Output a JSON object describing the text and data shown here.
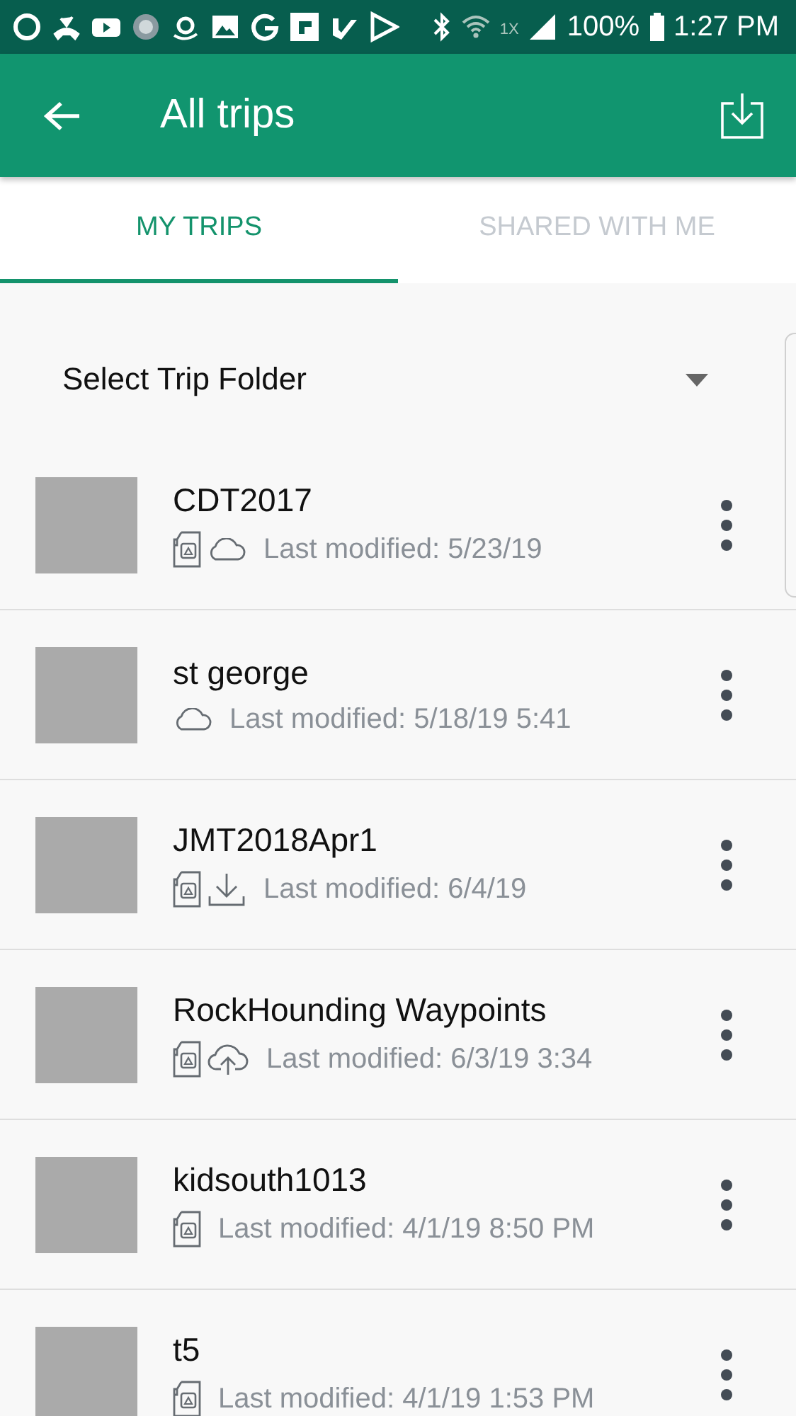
{
  "status_bar": {
    "network": "1X",
    "battery": "100%",
    "time": "1:27 PM"
  },
  "app_bar": {
    "title": "All trips"
  },
  "tabs": [
    {
      "label": "MY TRIPS",
      "selected": true
    },
    {
      "label": "SHARED WITH ME",
      "selected": false
    }
  ],
  "folder_select": {
    "label": "Select Trip Folder"
  },
  "trips": [
    {
      "name": "CDT2017",
      "modified": "Last modified: 5/23/19",
      "badges": [
        {
          "kind": "sd"
        },
        {
          "kind": "cloud"
        }
      ]
    },
    {
      "name": "st george",
      "modified": "Last modified: 5/18/19 5:41",
      "badges": [
        {
          "kind": "cloud"
        }
      ]
    },
    {
      "name": "JMT2018Apr1",
      "modified": "Last modified: 6/4/19",
      "badges": [
        {
          "kind": "sd"
        },
        {
          "kind": "download"
        }
      ]
    },
    {
      "name": "RockHounding Waypoints",
      "modified": "Last modified: 6/3/19 3:34",
      "badges": [
        {
          "kind": "sd"
        },
        {
          "kind": "upload"
        }
      ]
    },
    {
      "name": "kidsouth1013",
      "modified": "Last modified: 4/1/19 8:50 PM",
      "badges": [
        {
          "kind": "sd"
        }
      ]
    },
    {
      "name": "t5",
      "modified": "Last modified: 4/1/19 1:53 PM",
      "badges": [
        {
          "kind": "sd"
        }
      ]
    }
  ]
}
